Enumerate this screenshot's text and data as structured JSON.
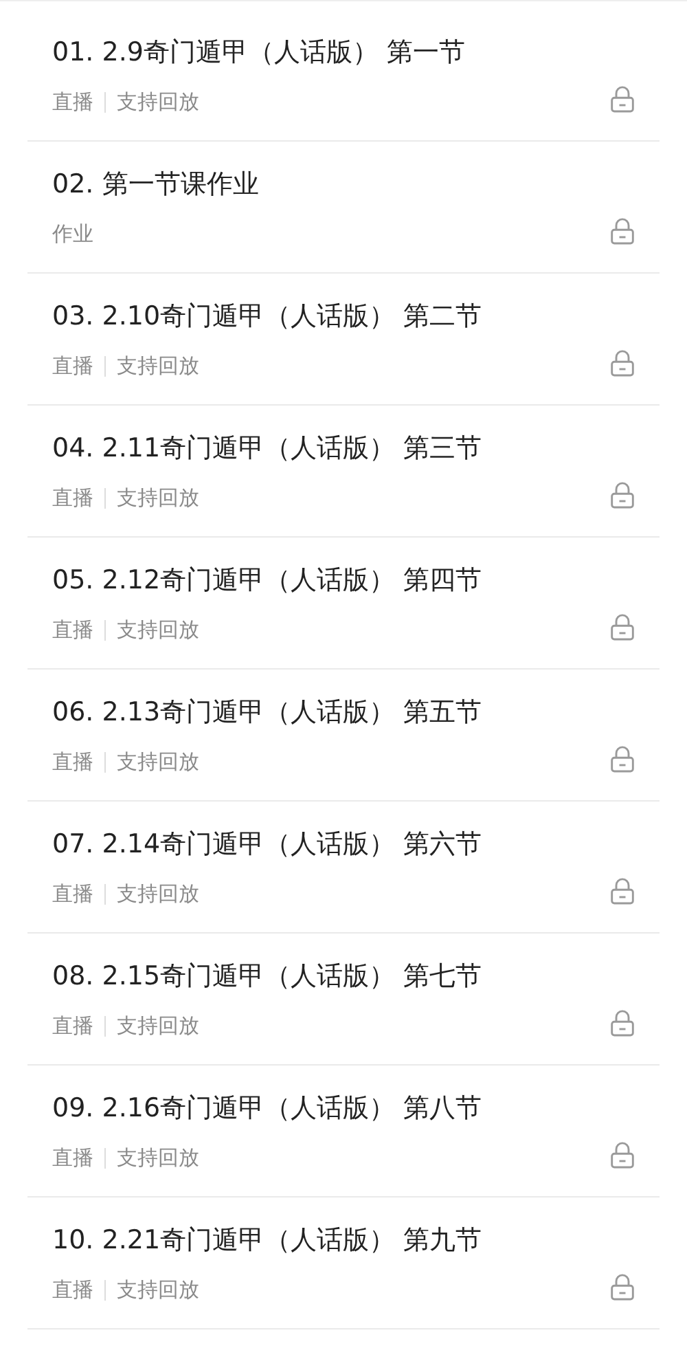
{
  "lessons": [
    {
      "title": "01. 2.9奇门遁甲（人话版） 第一节",
      "tags": [
        "直播",
        "支持回放"
      ],
      "locked": true
    },
    {
      "title": "02. 第一节课作业",
      "tags": [
        "作业"
      ],
      "locked": true
    },
    {
      "title": "03. 2.10奇门遁甲（人话版） 第二节",
      "tags": [
        "直播",
        "支持回放"
      ],
      "locked": true
    },
    {
      "title": "04. 2.11奇门遁甲（人话版） 第三节",
      "tags": [
        "直播",
        "支持回放"
      ],
      "locked": true
    },
    {
      "title": "05. 2.12奇门遁甲（人话版） 第四节",
      "tags": [
        "直播",
        "支持回放"
      ],
      "locked": true
    },
    {
      "title": "06. 2.13奇门遁甲（人话版） 第五节",
      "tags": [
        "直播",
        "支持回放"
      ],
      "locked": true
    },
    {
      "title": "07. 2.14奇门遁甲（人话版） 第六节",
      "tags": [
        "直播",
        "支持回放"
      ],
      "locked": true
    },
    {
      "title": "08. 2.15奇门遁甲（人话版） 第七节",
      "tags": [
        "直播",
        "支持回放"
      ],
      "locked": true
    },
    {
      "title": "09. 2.16奇门遁甲（人话版） 第八节",
      "tags": [
        "直播",
        "支持回放"
      ],
      "locked": true
    },
    {
      "title": "10. 2.21奇门遁甲（人话版） 第九节",
      "tags": [
        "直播",
        "支持回放"
      ],
      "locked": true
    }
  ]
}
